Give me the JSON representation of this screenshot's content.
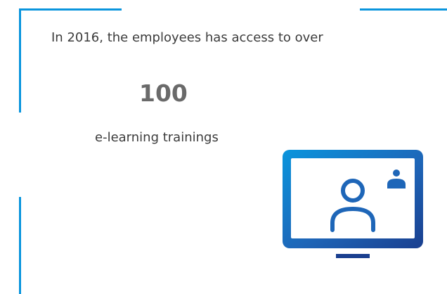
{
  "intro": {
    "text": "In 2016, the employees has access to over"
  },
  "stat": {
    "value": "100",
    "caption": "e-learning trainings"
  },
  "icons": {
    "main": "video-conference-monitor-icon"
  },
  "colors": {
    "accent": "#0a95dd",
    "icon_dark": "#1a3f8f",
    "text": "#3b3b3b",
    "number": "#6a6a6a"
  }
}
